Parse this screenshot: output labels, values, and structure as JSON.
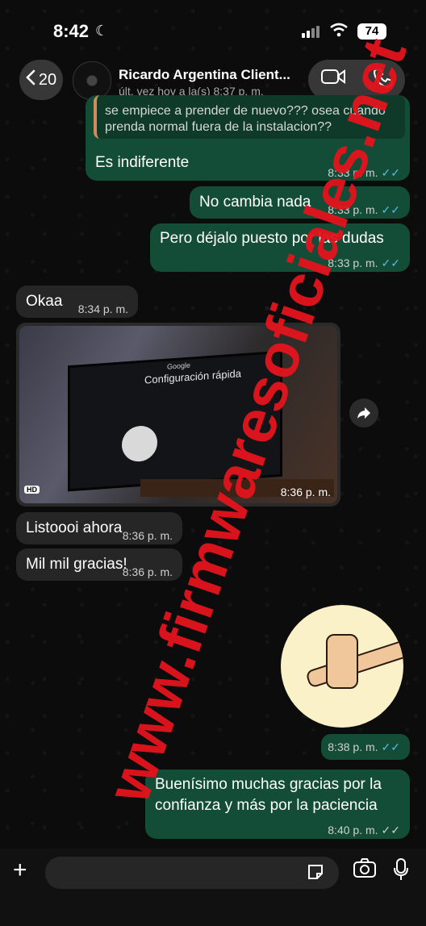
{
  "status_bar": {
    "time": "8:42",
    "battery": "74"
  },
  "header": {
    "back_count": "20",
    "contact_name": "Ricardo Argentina Client...",
    "contact_status": "últ. vez hoy a la(s) 8:37 p. m."
  },
  "messages": [
    {
      "dir": "out",
      "quoted_line1": "se empiece a prender de nuevo??? osea cuando",
      "quoted_line2": "prenda normal fuera de la instalacion??",
      "text": "Es indiferente",
      "time": "8:33 p. m."
    },
    {
      "dir": "out",
      "text": "No cambia nada",
      "time": "8:33 p. m."
    },
    {
      "dir": "out",
      "text": "Pero déjalo puesto por las dudas",
      "time": "8:33 p. m."
    },
    {
      "dir": "in",
      "text": "Okaa",
      "time": "8:34 p. m."
    },
    {
      "dir": "in",
      "type": "photo",
      "photo_text_logo": "Google",
      "photo_text_title": "Configuración rápida",
      "badge": "HD",
      "time": "8:36 p. m."
    },
    {
      "dir": "in",
      "text": "Listoooi ahora",
      "time": "8:36 p. m."
    },
    {
      "dir": "in",
      "text": "Mil mil gracias!",
      "time": "8:36 p. m."
    },
    {
      "dir": "out",
      "type": "sticker",
      "time": "8:38 p. m."
    },
    {
      "dir": "out",
      "text_line1": "Buenísimo muchas gracias por la",
      "text_line2": "confianza y más por la paciencia",
      "time": "8:40 p. m."
    }
  ],
  "watermark": "www.firmwaresoficiales.net",
  "icons": [
    "moon-icon",
    "signal-icon",
    "wifi-icon",
    "battery-icon",
    "back-chevron-icon",
    "video-call-icon",
    "phone-icon",
    "forward-icon",
    "plus-icon",
    "sticker-icon",
    "camera-icon",
    "microphone-icon",
    "double-check-icon"
  ],
  "colors": {
    "outgoing_bubble": "#144d37",
    "incoming_bubble": "#262626",
    "read_ticks": "#53bdeb",
    "watermark": "#e4141d"
  }
}
